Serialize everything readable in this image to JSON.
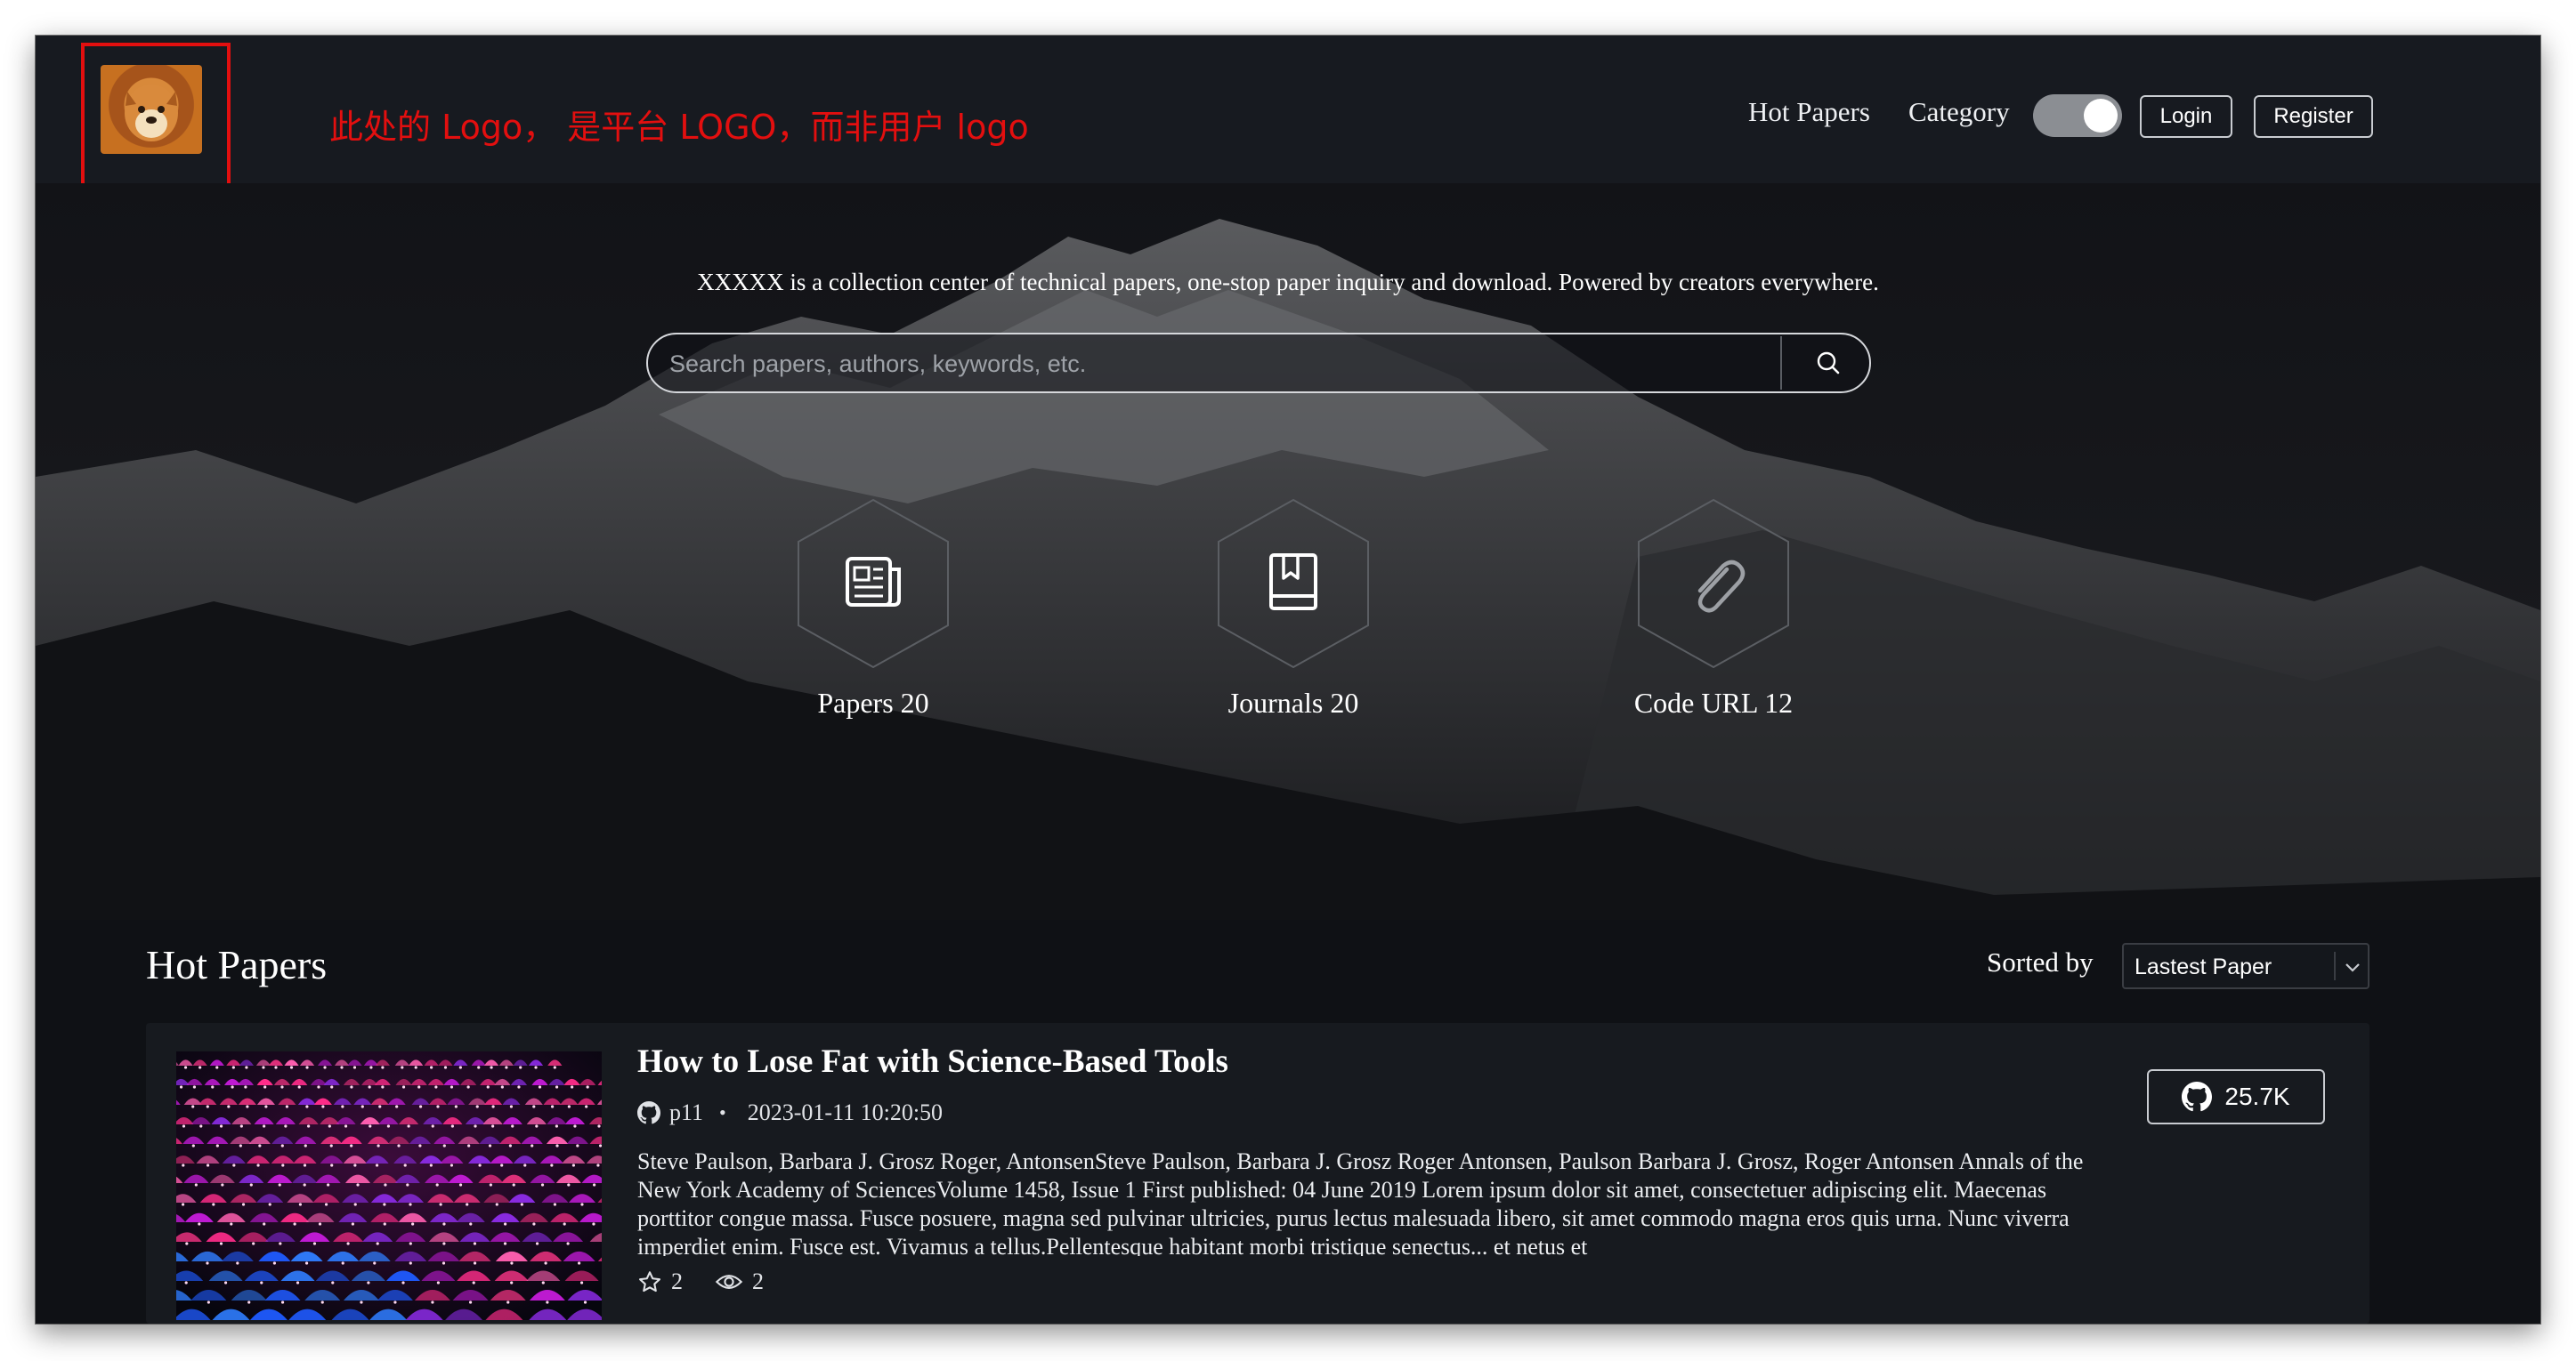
{
  "annotation": {
    "logo_note": "此处的 Logo， 是平台 LOGO，而非用户 logo"
  },
  "header": {
    "nav": {
      "hot_papers": "Hot Papers",
      "category": "Category"
    },
    "toggle_on": true,
    "login": "Login",
    "register": "Register"
  },
  "hero": {
    "tagline": "XXXXX is a collection center of technical papers, one-stop paper inquiry and download. Powered by creators everywhere.",
    "search_placeholder": "Search papers, authors, keywords, etc.",
    "stats": [
      {
        "label": "Papers 20",
        "icon": "newspaper-icon"
      },
      {
        "label": "Journals 20",
        "icon": "book-icon"
      },
      {
        "label": "Code URL 12",
        "icon": "paperclip-icon"
      }
    ]
  },
  "hot_papers": {
    "title": "Hot Papers",
    "sorted_by_label": "Sorted by",
    "sort_value": "Lastest Paper",
    "items": [
      {
        "title": "How to Lose Fat with Science-Based Tools",
        "username": "p11",
        "date": "2023-01-11 10:20:50",
        "description": "Steve Paulson, Barbara J. Grosz Roger, AntonsenSteve Paulson, Barbara J. Grosz Roger Antonsen, Paulson Barbara J. Grosz, Roger Antonsen Annals of the New York Academy of SciencesVolume 1458, Issue 1 First published: 04 June 2019 Lorem ipsum dolor sit amet, consectetuer adipiscing elit. Maecenas porttitor congue massa. Fusce posuere, magna sed pulvinar ultricies, purus lectus malesuada libero, sit amet commodo magna eros quis urna. Nunc viverra imperdiet enim. Fusce est. Vivamus a tellus.Pellentesque habitant morbi tristique senectus... et netus et",
        "stars": "2",
        "views": "2",
        "github_count": "25.7K"
      }
    ]
  },
  "colors": {
    "annotation_red": "#e30f0f",
    "background": "#0f1115",
    "header": "#171a20",
    "card": "#171a1f"
  }
}
